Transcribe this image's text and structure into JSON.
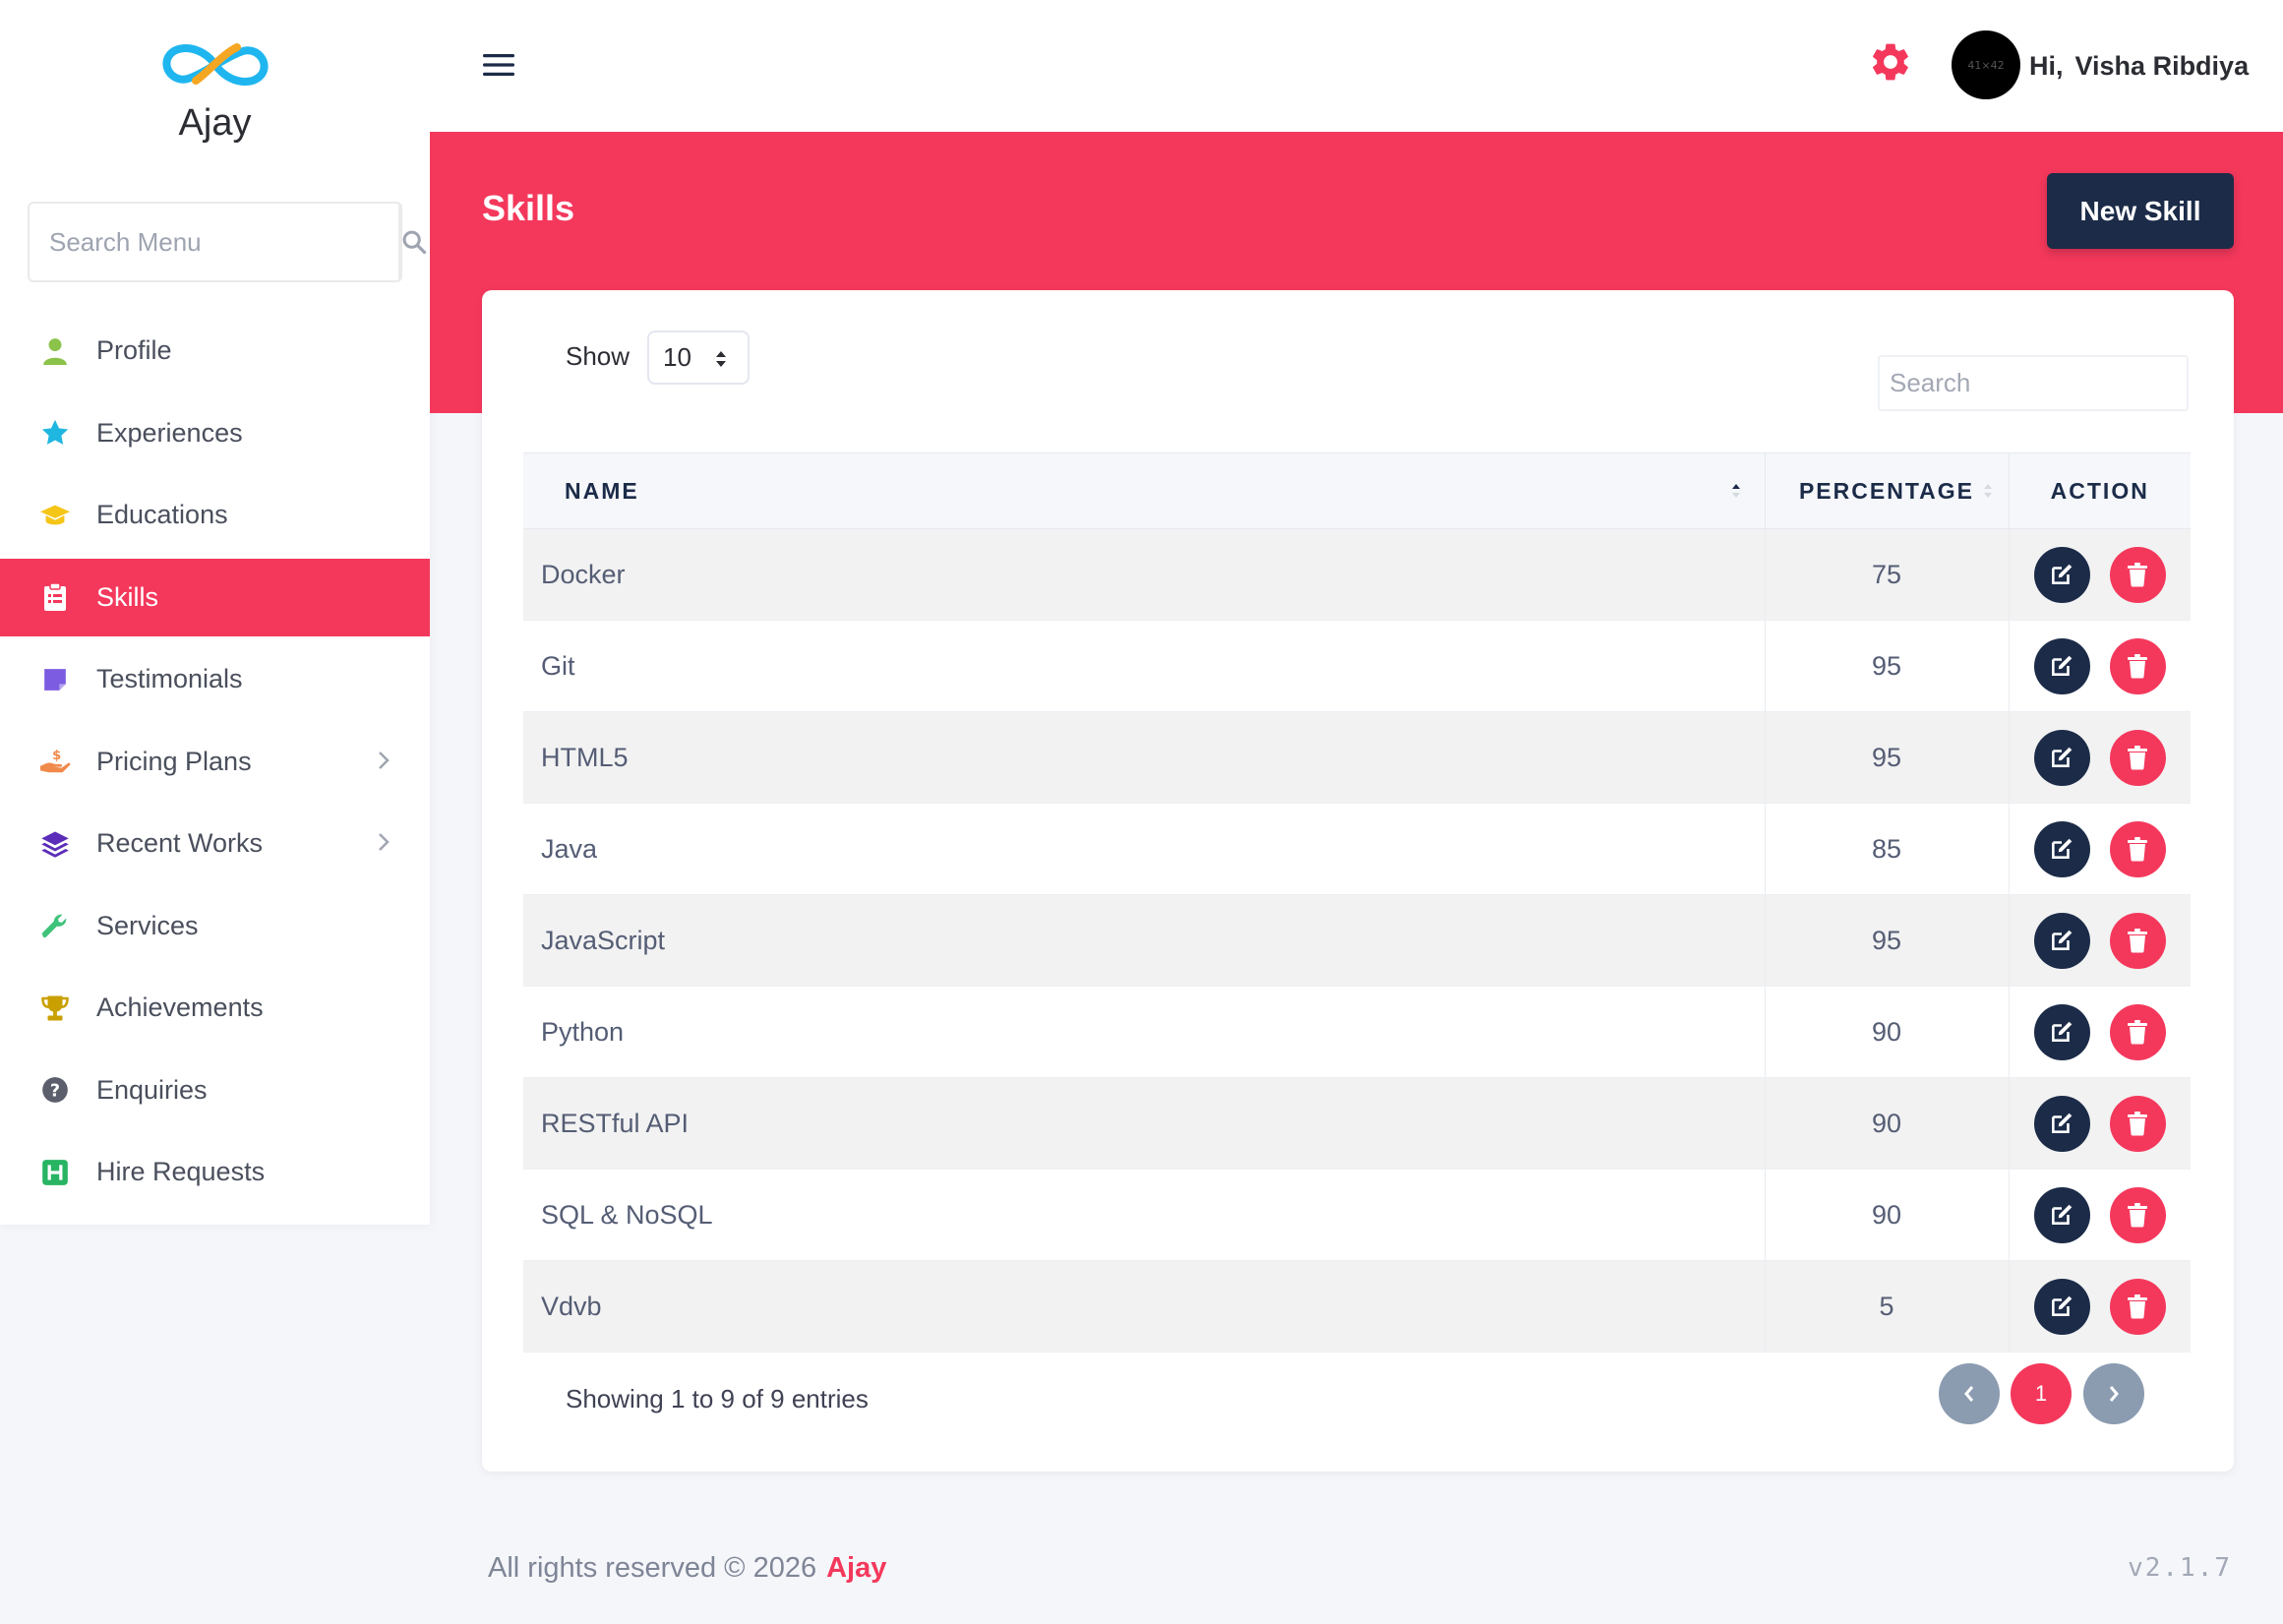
{
  "brand": {
    "name": "Ajay"
  },
  "sidebar": {
    "search_placeholder": "Search Menu",
    "items": [
      {
        "label": "Profile",
        "icon": "user-icon",
        "color": "#8bc34a"
      },
      {
        "label": "Experiences",
        "icon": "star-icon",
        "color": "#1fb6e0"
      },
      {
        "label": "Educations",
        "icon": "graduation-cap-icon",
        "color": "#f5c518"
      },
      {
        "label": "Skills",
        "icon": "clipboard-icon",
        "color": "#ffffff",
        "active": true
      },
      {
        "label": "Testimonials",
        "icon": "note-icon",
        "color": "#7c5ce0"
      },
      {
        "label": "Pricing Plans",
        "icon": "hand-dollar-icon",
        "color": "#f08a4b",
        "submenu": true
      },
      {
        "label": "Recent Works",
        "icon": "layers-icon",
        "color": "#5b2db8",
        "submenu": true
      },
      {
        "label": "Services",
        "icon": "wrench-icon",
        "color": "#3ec37a"
      },
      {
        "label": "Achievements",
        "icon": "trophy-icon",
        "color": "#c9a000"
      },
      {
        "label": "Enquiries",
        "icon": "question-circle-icon",
        "color": "#5b5f6b"
      },
      {
        "label": "Hire Requests",
        "icon": "h-square-icon",
        "color": "#28b463"
      }
    ]
  },
  "header": {
    "greeting": "Hi,",
    "user_name": "Visha Ribdiya",
    "avatar_text": "41×42"
  },
  "page": {
    "title": "Skills",
    "new_button": "New Skill"
  },
  "table": {
    "show_label": "Show",
    "page_size": "10",
    "search_placeholder": "Search",
    "columns": [
      "NAME",
      "PERCENTAGE",
      "ACTION"
    ],
    "rows": [
      {
        "name": "Docker",
        "percentage": "75"
      },
      {
        "name": "Git",
        "percentage": "95"
      },
      {
        "name": "HTML5",
        "percentage": "95"
      },
      {
        "name": "Java",
        "percentage": "85"
      },
      {
        "name": "JavaScript",
        "percentage": "95"
      },
      {
        "name": "Python",
        "percentage": "90"
      },
      {
        "name": "RESTful API",
        "percentage": "90"
      },
      {
        "name": "SQL & NoSQL",
        "percentage": "90"
      },
      {
        "name": "Vdvb",
        "percentage": "5"
      }
    ],
    "info": "Showing 1 to 9 of 9 entries",
    "current_page": "1"
  },
  "footer": {
    "copyright": "All rights reserved © 2026",
    "brand": "Ajay",
    "version": "v2.1.7"
  },
  "colors": {
    "accent": "#f4385c",
    "navy": "#1b2b48"
  }
}
